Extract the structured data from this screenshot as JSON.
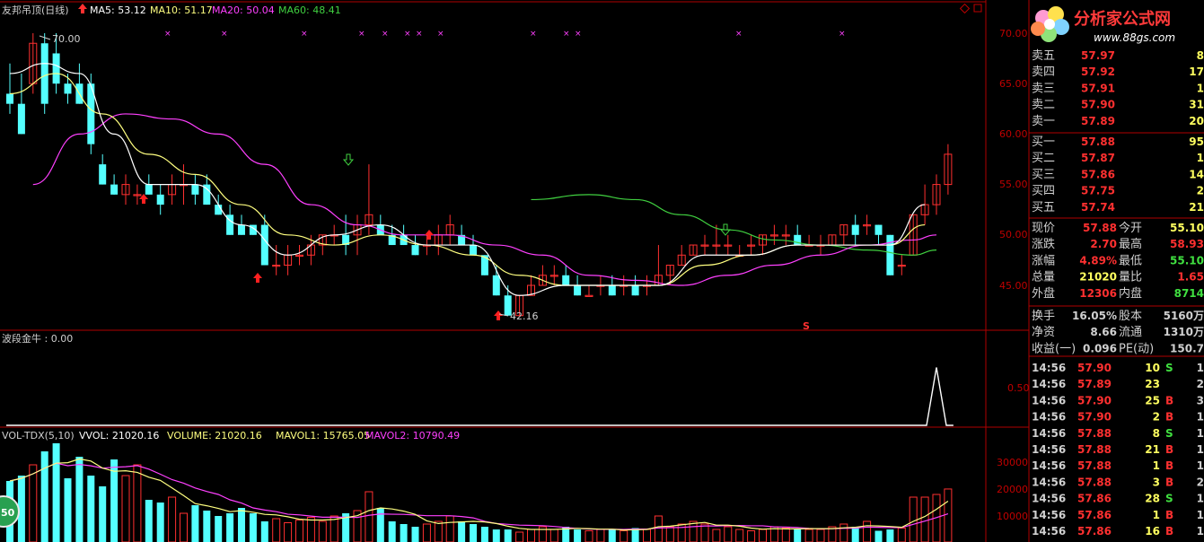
{
  "chart_header": {
    "title": "友邦吊顶(日线)",
    "ma5": "MA5: 53.12",
    "ma10": "MA10: 51.17",
    "ma20": "MA20: 50.04",
    "ma60": "MA60: 48.41"
  },
  "price_panel": {
    "y_ticks": [
      "70.00",
      "65.00",
      "60.00",
      "55.00",
      "50.00",
      "45.00"
    ],
    "high_marker": "70.00",
    "low_marker": "42.16",
    "s_marker": "S"
  },
  "indicator_panel": {
    "header": "波段金牛 : 0.00",
    "y_ticks": [
      "0.50"
    ]
  },
  "volume_panel": {
    "header_name": "VOL-TDX(5,10)",
    "vvol": "VVOL: 21020.16",
    "volume": "VOLUME: 21020.16",
    "mavol1": "MAVOL1: 15765.05",
    "mavol2": "MAVOL2: 10790.49",
    "y_ticks": [
      "30000",
      "20000",
      "10000"
    ],
    "badge": "50"
  },
  "logo": {
    "text": "分析家公式网",
    "url": "www.88gs.com"
  },
  "colors": {
    "up": "#ff3030",
    "down": "#54ffff",
    "ma5": "#ffffff",
    "ma10": "#ffff80",
    "ma20": "#ff40ff",
    "ma60": "#40d040",
    "grid": "#b00000"
  },
  "order_book": {
    "asks": [
      {
        "label": "卖五",
        "price": "57.97",
        "vol": "8"
      },
      {
        "label": "卖四",
        "price": "57.92",
        "vol": "17"
      },
      {
        "label": "卖三",
        "price": "57.91",
        "vol": "1"
      },
      {
        "label": "卖二",
        "price": "57.90",
        "vol": "31"
      },
      {
        "label": "卖一",
        "price": "57.89",
        "vol": "20"
      }
    ],
    "bids": [
      {
        "label": "买一",
        "price": "57.88",
        "vol": "95"
      },
      {
        "label": "买二",
        "price": "57.87",
        "vol": "1"
      },
      {
        "label": "买三",
        "price": "57.86",
        "vol": "14"
      },
      {
        "label": "买四",
        "price": "57.75",
        "vol": "2"
      },
      {
        "label": "买五",
        "price": "57.74",
        "vol": "21"
      }
    ]
  },
  "stats": [
    {
      "l1": "现价",
      "v1": "57.88",
      "l2": "今开",
      "v2": "55.10"
    },
    {
      "l1": "涨跌",
      "v1": "2.70",
      "l2": "最高",
      "v2": "58.93"
    },
    {
      "l1": "涨幅",
      "v1": "4.89%",
      "l2": "最低",
      "v2": "55.10"
    },
    {
      "l1": "总量",
      "v1": "21020",
      "l2": "量比",
      "v2": "1.65"
    },
    {
      "l1": "外盘",
      "v1": "12306",
      "l2": "内盘",
      "v2": "8714"
    }
  ],
  "fundamentals": [
    {
      "l1": "换手",
      "v1": "16.05%",
      "l2": "股本",
      "v2": "5160万"
    },
    {
      "l1": "净资",
      "v1": "8.66",
      "l2": "流通",
      "v2": "1310万"
    },
    {
      "l1": "收益(一)",
      "v1": "0.096",
      "l2": "PE(动)",
      "v2": "150.7"
    }
  ],
  "ticks": [
    {
      "time": "14:56",
      "price": "57.90",
      "vol": "10",
      "side": "S",
      "n": "1"
    },
    {
      "time": "14:56",
      "price": "57.89",
      "vol": "23",
      "side": "",
      "n": "2"
    },
    {
      "time": "14:56",
      "price": "57.90",
      "vol": "25",
      "side": "B",
      "n": "3"
    },
    {
      "time": "14:56",
      "price": "57.90",
      "vol": "2",
      "side": "B",
      "n": "1"
    },
    {
      "time": "14:56",
      "price": "57.88",
      "vol": "8",
      "side": "S",
      "n": "1"
    },
    {
      "time": "14:56",
      "price": "57.88",
      "vol": "21",
      "side": "B",
      "n": "1"
    },
    {
      "time": "14:56",
      "price": "57.88",
      "vol": "1",
      "side": "B",
      "n": "1"
    },
    {
      "time": "14:56",
      "price": "57.88",
      "vol": "3",
      "side": "B",
      "n": "2"
    },
    {
      "time": "14:56",
      "price": "57.86",
      "vol": "28",
      "side": "S",
      "n": "1"
    },
    {
      "time": "14:56",
      "price": "57.86",
      "vol": "1",
      "side": "B",
      "n": "1"
    },
    {
      "time": "14:56",
      "price": "57.86",
      "vol": "16",
      "side": "B",
      "n": "1"
    }
  ],
  "chart_data": {
    "type": "candlestick",
    "price_range": [
      40.5,
      72
    ],
    "candles": [
      [
        64,
        67,
        62,
        63
      ],
      [
        63,
        66,
        60,
        60
      ],
      [
        65,
        70,
        64,
        69
      ],
      [
        69,
        70,
        62,
        63
      ],
      [
        68,
        70,
        64,
        65
      ],
      [
        65,
        66,
        63,
        64
      ],
      [
        65,
        67,
        63,
        63
      ],
      [
        65,
        66,
        58,
        59
      ],
      [
        57,
        58,
        55,
        55
      ],
      [
        55,
        56,
        54,
        54
      ],
      [
        54,
        56,
        53,
        55
      ],
      [
        54,
        55,
        53,
        54
      ],
      [
        55,
        56,
        54,
        54
      ],
      [
        54,
        55,
        52,
        53
      ],
      [
        54,
        56,
        53,
        55
      ],
      [
        55,
        57,
        53,
        55
      ],
      [
        55,
        56,
        53,
        54
      ],
      [
        55,
        56,
        53,
        53
      ],
      [
        53,
        54,
        52,
        52
      ],
      [
        52,
        53,
        50,
        50
      ],
      [
        51,
        52,
        50,
        50
      ],
      [
        51,
        51,
        50,
        50
      ],
      [
        51,
        52,
        47,
        47
      ],
      [
        47,
        49,
        46,
        47
      ],
      [
        47,
        49,
        46,
        48
      ],
      [
        48,
        49,
        47,
        48
      ],
      [
        48,
        50,
        47,
        49
      ],
      [
        49,
        50,
        48,
        50
      ],
      [
        50,
        51,
        49,
        50
      ],
      [
        50,
        52,
        48,
        49
      ],
      [
        50,
        52,
        48,
        51
      ],
      [
        51,
        57,
        50,
        52
      ],
      [
        51,
        52,
        50,
        50
      ],
      [
        50,
        51,
        49,
        49
      ],
      [
        50,
        51,
        49,
        49
      ],
      [
        49,
        50,
        48,
        48
      ],
      [
        49,
        50,
        48,
        49
      ],
      [
        49,
        51,
        48,
        50
      ],
      [
        50,
        52,
        49,
        51
      ],
      [
        50,
        51,
        49,
        49
      ],
      [
        49,
        50,
        48,
        48
      ],
      [
        48,
        48,
        46,
        46
      ],
      [
        46,
        47,
        44,
        44
      ],
      [
        44,
        45,
        42,
        42
      ],
      [
        42,
        44,
        42,
        44
      ],
      [
        44,
        46,
        44,
        45
      ],
      [
        45,
        47,
        45,
        46
      ],
      [
        46,
        47,
        45,
        46
      ],
      [
        46,
        47,
        45,
        45
      ],
      [
        45,
        46,
        44,
        44
      ],
      [
        44,
        45,
        44,
        44
      ],
      [
        45,
        46,
        44,
        45
      ],
      [
        45,
        46,
        44,
        44
      ],
      [
        45,
        46,
        44,
        45
      ],
      [
        45,
        46,
        44,
        44
      ],
      [
        45,
        46,
        44,
        45
      ],
      [
        45,
        49,
        45,
        46
      ],
      [
        46,
        47,
        45,
        47
      ],
      [
        47,
        49,
        47,
        48
      ],
      [
        48,
        49,
        48,
        49
      ],
      [
        49,
        50,
        48,
        49
      ],
      [
        49,
        51,
        48,
        49
      ],
      [
        49,
        50,
        48,
        49
      ],
      [
        48,
        49,
        48,
        48
      ],
      [
        49,
        50,
        48,
        49
      ],
      [
        49,
        50,
        48,
        50
      ],
      [
        50,
        51,
        49,
        50
      ],
      [
        50,
        51,
        49,
        50
      ],
      [
        50,
        51,
        49,
        49
      ],
      [
        49,
        50,
        49,
        49
      ],
      [
        49,
        50,
        48,
        49
      ],
      [
        49,
        50,
        49,
        50
      ],
      [
        50,
        51,
        49,
        51
      ],
      [
        51,
        52,
        49,
        50
      ],
      [
        51,
        52,
        50,
        51
      ],
      [
        51,
        51,
        49,
        50
      ],
      [
        50,
        50,
        46,
        46
      ],
      [
        47,
        48,
        46,
        47
      ],
      [
        48,
        52,
        48,
        52
      ],
      [
        52,
        55,
        51,
        53
      ],
      [
        53,
        56,
        52,
        55
      ],
      [
        55,
        59,
        54,
        58
      ]
    ],
    "ma5_anchor": [
      [
        0,
        66
      ],
      [
        3,
        67
      ],
      [
        6,
        66
      ],
      [
        9,
        60
      ],
      [
        12,
        55
      ],
      [
        16,
        55
      ],
      [
        20,
        51
      ],
      [
        24,
        48
      ],
      [
        28,
        50
      ],
      [
        32,
        51
      ],
      [
        36,
        49
      ],
      [
        40,
        49
      ],
      [
        44,
        44
      ],
      [
        48,
        45
      ],
      [
        52,
        45
      ],
      [
        56,
        45
      ],
      [
        60,
        48
      ],
      [
        64,
        48
      ],
      [
        68,
        49
      ],
      [
        72,
        49
      ],
      [
        76,
        49
      ],
      [
        79,
        53
      ]
    ],
    "ma10_anchor": [
      [
        0,
        64
      ],
      [
        4,
        66
      ],
      [
        8,
        62
      ],
      [
        12,
        58
      ],
      [
        16,
        56
      ],
      [
        20,
        53
      ],
      [
        24,
        50
      ],
      [
        28,
        49
      ],
      [
        32,
        50
      ],
      [
        36,
        49
      ],
      [
        40,
        48
      ],
      [
        44,
        46
      ],
      [
        48,
        45
      ],
      [
        52,
        45
      ],
      [
        56,
        45
      ],
      [
        60,
        47
      ],
      [
        64,
        48
      ],
      [
        68,
        49
      ],
      [
        72,
        49
      ],
      [
        76,
        49
      ],
      [
        79,
        51
      ]
    ],
    "ma20_anchor": [
      [
        2,
        55
      ],
      [
        6,
        60
      ],
      [
        10,
        62
      ],
      [
        14,
        61.5
      ],
      [
        18,
        60
      ],
      [
        22,
        57
      ],
      [
        26,
        53
      ],
      [
        30,
        51
      ],
      [
        34,
        50
      ],
      [
        38,
        50
      ],
      [
        42,
        49
      ],
      [
        46,
        48
      ],
      [
        50,
        46
      ],
      [
        54,
        45.5
      ],
      [
        58,
        45
      ],
      [
        62,
        46
      ],
      [
        66,
        47
      ],
      [
        70,
        48
      ],
      [
        74,
        49
      ],
      [
        78,
        49.5
      ],
      [
        80,
        50
      ]
    ],
    "ma60_anchor": [
      [
        45,
        53.5
      ],
      [
        50,
        54
      ],
      [
        54,
        53.5
      ],
      [
        58,
        52
      ],
      [
        62,
        50.5
      ],
      [
        66,
        49.5
      ],
      [
        70,
        49
      ],
      [
        74,
        48.5
      ],
      [
        78,
        48
      ],
      [
        80,
        48.5
      ]
    ],
    "indicator_peak": {
      "index": 80,
      "value": 0.75
    },
    "volume_range": [
      0,
      40000
    ],
    "volumes": [
      24000,
      26000,
      30000,
      35000,
      38000,
      25000,
      33000,
      26000,
      22000,
      32000,
      26000,
      30000,
      17000,
      16000,
      18000,
      12000,
      15000,
      13000,
      11000,
      12000,
      14000,
      12000,
      9000,
      10000,
      8500,
      9500,
      10500,
      9000,
      11000,
      12000,
      13000,
      20000,
      14000,
      9000,
      8000,
      7000,
      8000,
      9000,
      11000,
      9000,
      8000,
      7000,
      6000,
      6000,
      5000,
      6000,
      7000,
      6000,
      7000,
      6000,
      5500,
      6000,
      6000,
      5500,
      6500,
      6000,
      11000,
      7000,
      8000,
      9000,
      8000,
      6000,
      7000,
      6000,
      5500,
      6000,
      7000,
      6500,
      6000,
      6000,
      6000,
      7000,
      8000,
      7000,
      9000,
      5500,
      6000,
      6500,
      18000,
      18000,
      19000,
      21020
    ]
  }
}
